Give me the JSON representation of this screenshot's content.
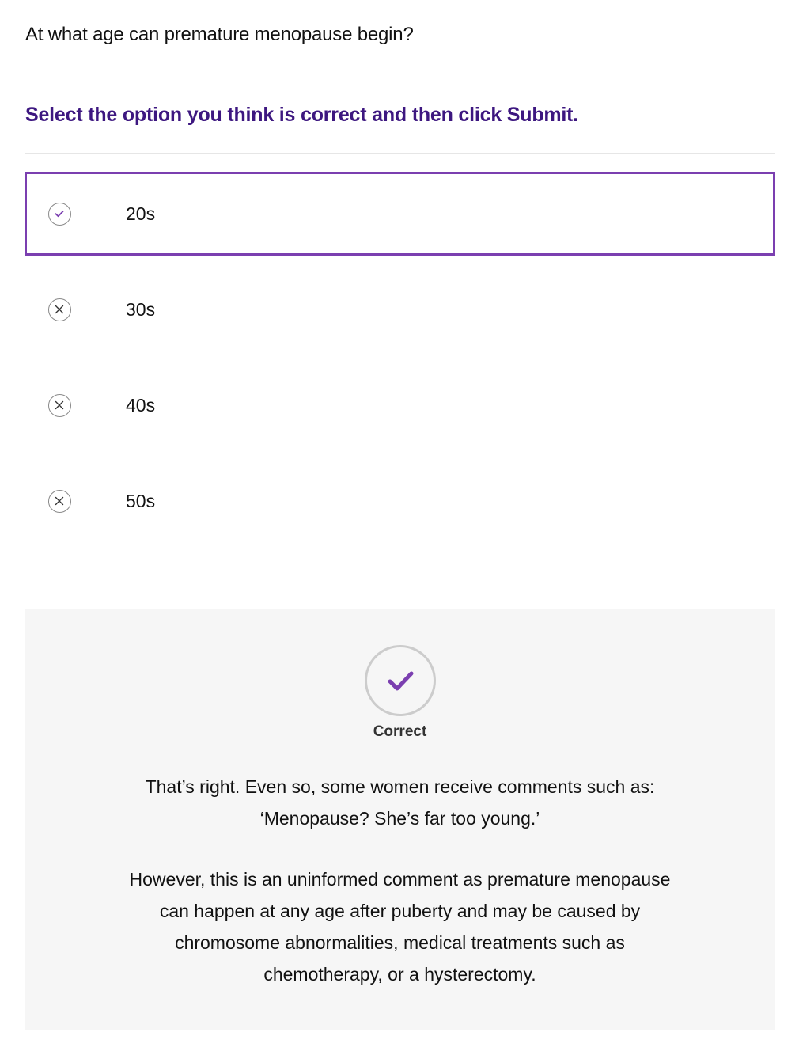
{
  "question": "At what age can premature menopause begin?",
  "instruction": "Select the option you think is correct and then click Submit.",
  "options": [
    {
      "label": "20s",
      "state": "correct",
      "selected": true
    },
    {
      "label": "30s",
      "state": "incorrect",
      "selected": false
    },
    {
      "label": "40s",
      "state": "incorrect",
      "selected": false
    },
    {
      "label": "50s",
      "state": "incorrect",
      "selected": false
    }
  ],
  "feedback": {
    "icon": "check-icon",
    "status": "Correct",
    "paragraph1_line1": "That’s right. Even so, some women receive comments such as:",
    "paragraph1_line2": "‘Menopause? She’s far too young.’",
    "paragraph2_line1": "However, this is an uninformed comment as premature menopause",
    "paragraph2_line2": "can happen at any age after puberty and may be caused by",
    "paragraph2_line3": "chromosome abnormalities, medical treatments such as",
    "paragraph2_line4": "chemotherapy, or a hysterectomy."
  },
  "colors": {
    "accent": "#7b3fb0",
    "instruction_text": "#3d1780",
    "feedback_background": "#f6f6f6"
  }
}
